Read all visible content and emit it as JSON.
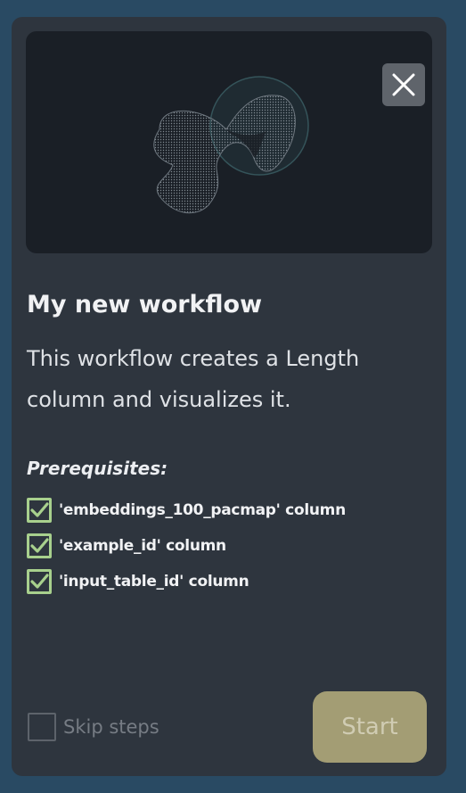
{
  "dialog": {
    "title": "My new workflow",
    "description": "This workflow creates a Length column and visualizes it.",
    "close_icon": "close-icon",
    "illustration": "embedding-blob-illustration"
  },
  "prerequisites": {
    "heading": "Prerequisites:",
    "items": [
      {
        "label": "'embeddings_100_pacmap' column",
        "checked": true
      },
      {
        "label": "'example_id' column",
        "checked": true
      },
      {
        "label": "'input_table_id' column",
        "checked": true
      }
    ]
  },
  "footer": {
    "skip_label": "Skip steps",
    "skip_checked": false,
    "start_label": "Start"
  },
  "colors": {
    "background": "#294a63",
    "card": "#2e353e",
    "check_accent": "#a8d08d",
    "start_button": "#a39d74"
  }
}
